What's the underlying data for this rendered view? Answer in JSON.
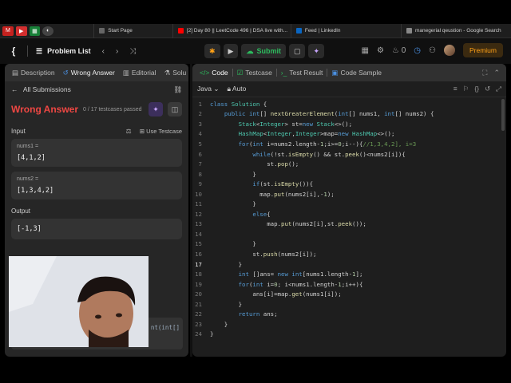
{
  "browser": {
    "tabs": [
      {
        "label": "Start Page",
        "color": "#666666"
      },
      {
        "label": "[2] Day 80 || LeetCode 496 | DSA live with...",
        "color": "#ff0000"
      },
      {
        "label": "Feed | LinkedIn",
        "color": "#0a66c2"
      },
      {
        "label": "manegerial qeustion - Google Search",
        "color": "#888888"
      }
    ]
  },
  "nav": {
    "problem_list": "Problem List",
    "submit": "Submit",
    "streak": "0",
    "premium": "Premium"
  },
  "left": {
    "tabs": [
      "Description",
      "Wrong Answer",
      "Editorial",
      "Solu"
    ],
    "all_submissions": "All Submissions",
    "result_title": "Wrong Answer",
    "result_sub": "0 / 17 testcases passed",
    "input_label": "Input",
    "use_testcase": "Use Testcase",
    "fields": [
      {
        "label": "nums1 =",
        "value": "[4,1,2]"
      },
      {
        "label": "nums2 =",
        "value": "[1,3,4,2]"
      }
    ],
    "output_label": "Output",
    "output_value": "[-1,3]",
    "peek": [
      "nt(int[]",
      "3    Stack<Integer> st=new Stack<>();"
    ]
  },
  "editor": {
    "tabs": [
      "Code",
      "Testcase",
      "Test Result",
      "Code Sample"
    ],
    "language": "Java",
    "auto": "Auto",
    "current_line": 17,
    "lines": [
      "class Solution {",
      "    public int[] nextGreaterElement(int[] nums1, int[] nums2) {",
      "        Stack<Integer> st=new Stack<>();",
      "        HashMap<Integer,Integer>map=new HashMap<>();",
      "        for(int i=nums2.length-1;i>=0;i--){//1,3,4,2], i=3",
      "            while(!st.isEmpty() && st.peek()<nums2[i]){",
      "                st.pop();",
      "            }",
      "            if(st.isEmpty()){",
      "              map.put(nums2[i],-1);",
      "            }",
      "            else{",
      "                map.put(nums2[i],st.peek());",
      "",
      "            }",
      "            st.push(nums2[i]);",
      "        }",
      "        int []ans= new int[nums1.length-1];",
      "        for(int i=0; i<nums1.length-1;i++){",
      "            ans[i]=map.get(nums1[i]);",
      "        }",
      "        return ans;",
      "    }",
      "}"
    ]
  },
  "colors": {
    "wrong": "#ef4743",
    "submit": "#2cbb5d",
    "premium": "#ffa116"
  }
}
